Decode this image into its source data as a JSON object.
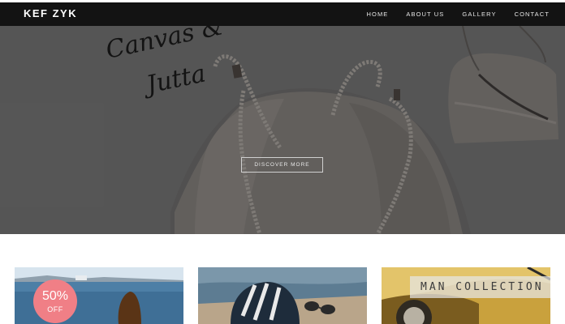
{
  "brand": "KEF ZYK",
  "nav": [
    {
      "label": "HOME"
    },
    {
      "label": "ABOUT US"
    },
    {
      "label": "GALLERY"
    },
    {
      "label": "CONTACT"
    }
  ],
  "hero": {
    "button_label": "DISCOVER MORE",
    "script_text": "Canvas & Jutta"
  },
  "cards": {
    "sale": {
      "percent": "50%",
      "off": "OFF"
    },
    "man_collection": "MAN COLLECTION"
  },
  "colors": {
    "navbar": "#131313",
    "hero_bg": "#5c5c5c",
    "sale_badge": "#f07f86"
  }
}
